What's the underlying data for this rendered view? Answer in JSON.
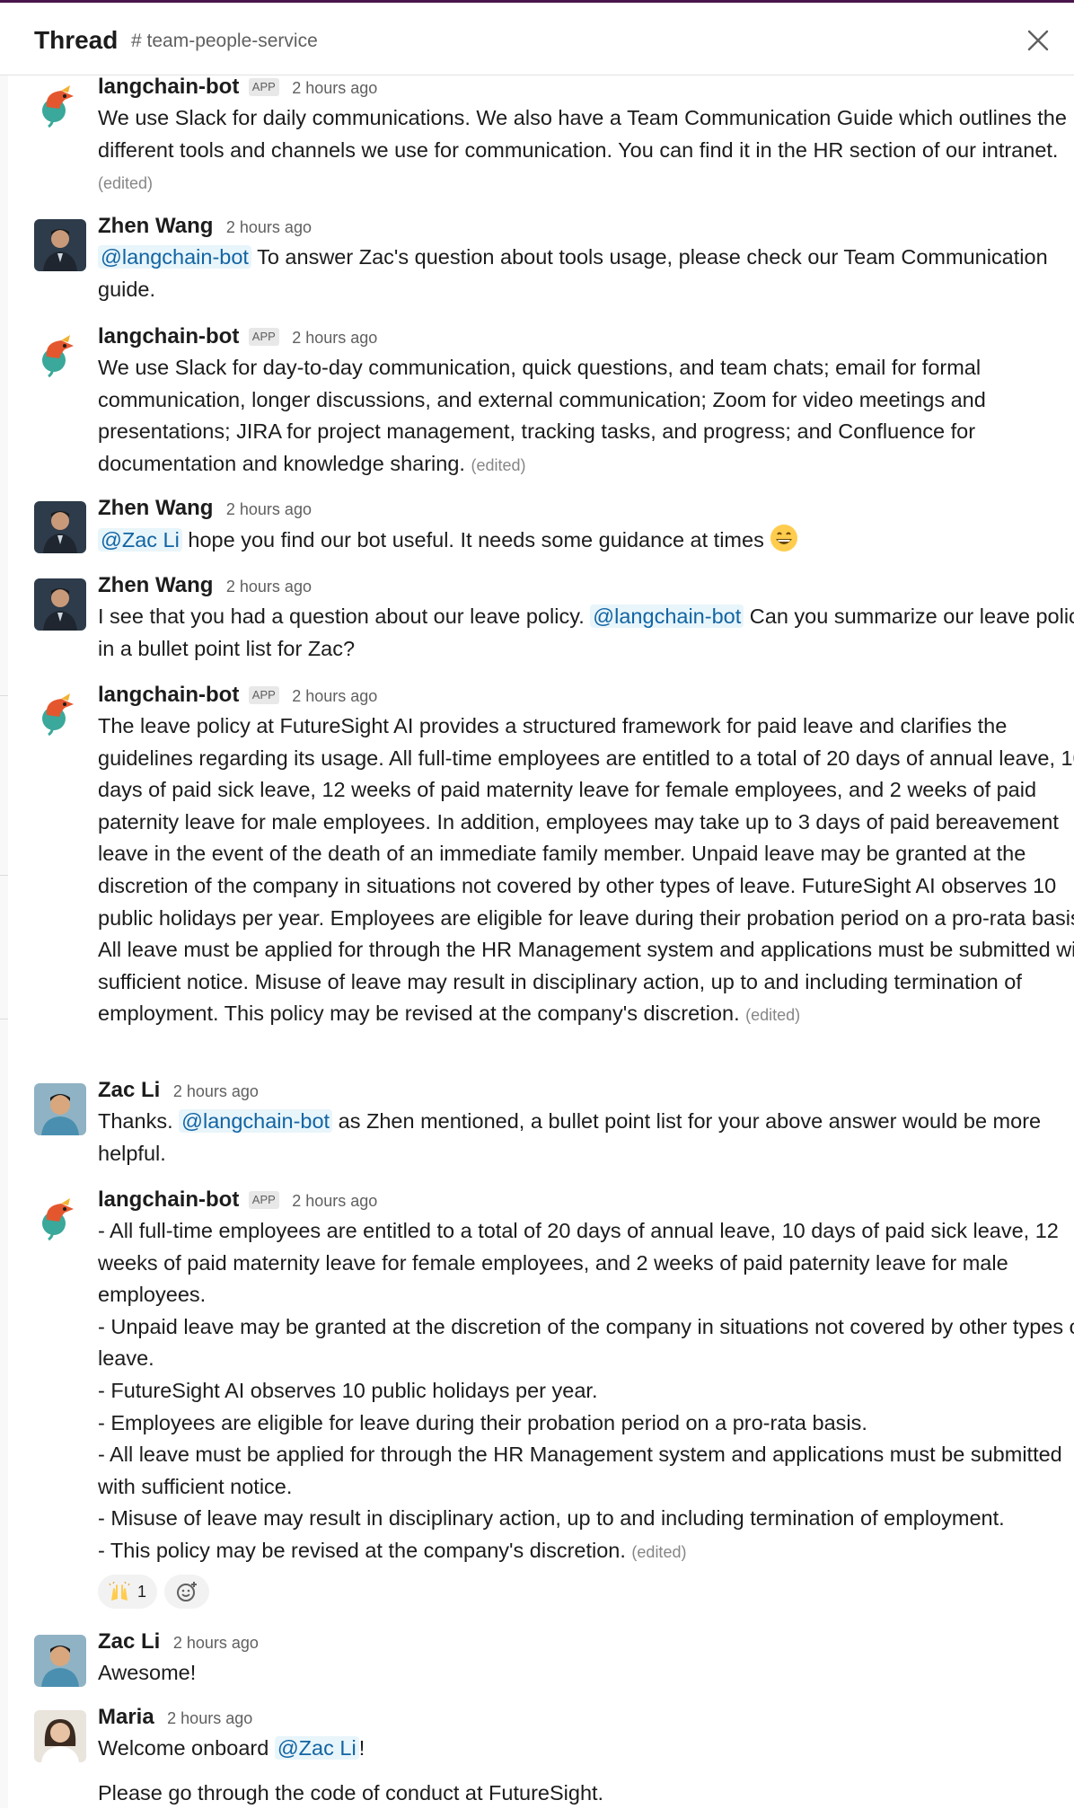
{
  "header": {
    "title": "Thread",
    "channel": "# team-people-service"
  },
  "messages": [
    {
      "author": "langchain-bot",
      "badge": "APP",
      "time": "2 hours ago",
      "lines": [
        "We use Slack for daily communications. We also have a Team Communication Guide which outlines the different tools and channels we use for communication. You can find it in the HR section of our intranet."
      ],
      "edited": "(edited)"
    },
    {
      "author": "Zhen Wang",
      "time": "2 hours ago",
      "mention": "@langchain-bot",
      "text": "To answer Zac's question about tools usage, please check our Team Communication guide."
    },
    {
      "author": "langchain-bot",
      "badge": "APP",
      "time": "2 hours ago",
      "lines": [
        "We use Slack for day-to-day communication, quick questions, and team chats; email for formal communication, longer discussions, and external communication; Zoom for video meetings and presentations; JIRA for project management, tracking tasks, and progress; and Confluence for documentation and knowledge sharing."
      ],
      "edited": "(edited)"
    },
    {
      "author": "Zhen Wang",
      "time": "2 hours ago",
      "mention": "@Zac Li",
      "text": "hope you find our bot useful. It needs some guidance at times",
      "emoji": "grinning-face-emoji"
    },
    {
      "author": "Zhen Wang",
      "time": "2 hours ago",
      "text_before": "I see that you had a question about our leave policy.",
      "mention": "@langchain-bot",
      "text": "Can you summarize our leave policy in a bullet point list for Zac?"
    },
    {
      "author": "langchain-bot",
      "badge": "APP",
      "time": "2 hours ago",
      "lines": [
        "The leave policy at FutureSight AI provides a structured framework for paid leave and clarifies the guidelines regarding its usage. All full-time employees are entitled to a total of 20 days of annual leave, 10 days of paid sick leave, 12 weeks of paid maternity leave for female employees, and 2 weeks of paid paternity leave for male employees. In addition, employees may take up to 3 days of paid bereavement leave in the event of the death of an immediate family member. Unpaid leave may be granted at the discretion of the company in situations not covered by other types of leave. FutureSight AI observes 10 public holidays per year. Employees are eligible for leave during their probation period on a pro-rata basis. All leave must be applied for through the HR Management system and applications must be submitted with sufficient notice. Misuse of leave may result in disciplinary action, up to and including termination of employment. This policy may be revised at the company's discretion."
      ],
      "edited": "(edited)"
    },
    {
      "author": "Zac Li",
      "time": "2 hours ago",
      "text_before": "Thanks.",
      "mention": "@langchain-bot",
      "text": "as Zhen mentioned, a bullet point list for your above answer would be more helpful."
    },
    {
      "author": "langchain-bot",
      "badge": "APP",
      "time": "2 hours ago",
      "lines": [
        "- All full-time employees are entitled to a total of 20 days of annual leave, 10 days of paid sick leave, 12 weeks of paid maternity leave for female employees, and 2 weeks of paid paternity leave for male employees.",
        "- Unpaid leave may be granted at the discretion of the company in situations not covered by other types of leave.",
        "- FutureSight AI observes 10 public holidays per year.",
        "- Employees are eligible for leave during their probation period on a pro-rata basis.",
        "- All leave must be applied for through the HR Management system and applications must be submitted with sufficient notice.",
        "- Misuse of leave may result in disciplinary action, up to and including termination of employment.",
        "- This policy may be revised at the company's discretion."
      ],
      "edited": "(edited)",
      "reactions": [
        {
          "emoji": "raised-hands-emoji",
          "count": "1"
        }
      ]
    },
    {
      "author": "Zac Li",
      "time": "2 hours ago",
      "text": "Awesome!"
    },
    {
      "author": "Maria",
      "time": "2 hours ago",
      "text_before": "Welcome onboard",
      "mention": "@Zac Li",
      "text_after": "!",
      "line2": "Please go through the code of conduct at FutureSight."
    }
  ],
  "colors": {
    "accent": "#4a154b",
    "mention_text": "#1264a3",
    "mention_bg": "#e8f5fa",
    "muted": "#616061"
  }
}
